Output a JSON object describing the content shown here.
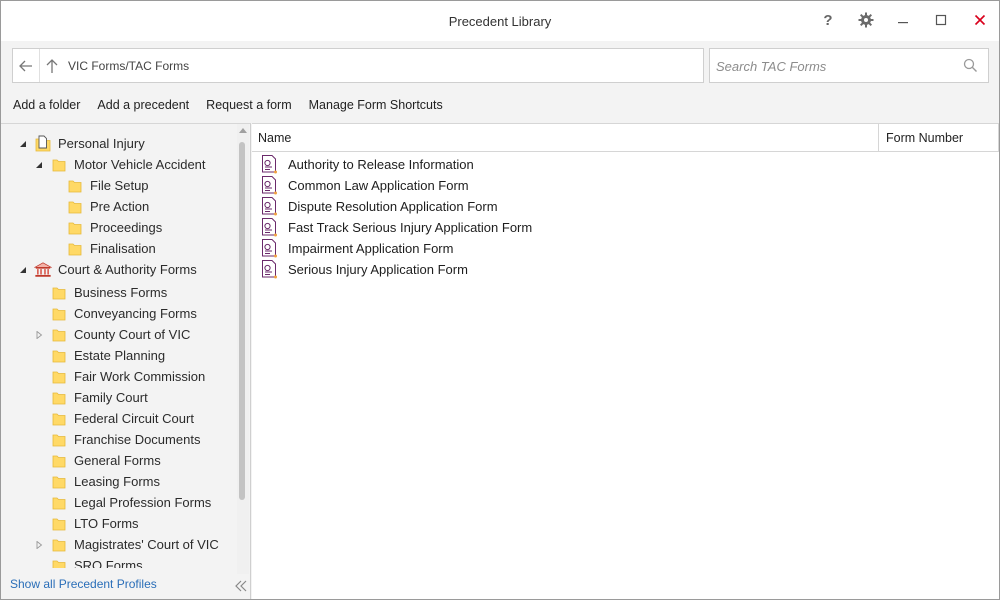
{
  "window": {
    "title": "Precedent Library"
  },
  "titlebar": {
    "help_label": "?"
  },
  "nav": {
    "path": "VIC Forms/TAC Forms"
  },
  "search": {
    "placeholder": "Search TAC Forms"
  },
  "toolbar": {
    "items": [
      "Add a folder",
      "Add a precedent",
      "Request a form",
      "Manage Form Shortcuts"
    ]
  },
  "tree": {
    "nodes": [
      {
        "label": "Personal Injury",
        "level": 0,
        "expander": "expanded",
        "icon": "document-folder-icon"
      },
      {
        "label": "Motor Vehicle Accident",
        "level": 1,
        "expander": "expanded",
        "icon": "folder-icon"
      },
      {
        "label": "File Setup",
        "level": 2,
        "expander": "none",
        "icon": "folder-icon"
      },
      {
        "label": "Pre Action",
        "level": 2,
        "expander": "none",
        "icon": "folder-icon"
      },
      {
        "label": "Proceedings",
        "level": 2,
        "expander": "none",
        "icon": "folder-icon"
      },
      {
        "label": "Finalisation",
        "level": 2,
        "expander": "none",
        "icon": "folder-icon"
      },
      {
        "label": "Court & Authority Forms",
        "level": 0,
        "expander": "expanded",
        "icon": "courthouse-icon"
      },
      {
        "label": "Business Forms",
        "level": 1,
        "expander": "none",
        "icon": "folder-icon"
      },
      {
        "label": "Conveyancing Forms",
        "level": 1,
        "expander": "none",
        "icon": "folder-icon"
      },
      {
        "label": "County Court of VIC",
        "level": 1,
        "expander": "collapsed",
        "icon": "folder-icon"
      },
      {
        "label": "Estate Planning",
        "level": 1,
        "expander": "none",
        "icon": "folder-icon"
      },
      {
        "label": "Fair Work Commission",
        "level": 1,
        "expander": "none",
        "icon": "folder-icon"
      },
      {
        "label": "Family Court",
        "level": 1,
        "expander": "none",
        "icon": "folder-icon"
      },
      {
        "label": "Federal Circuit Court",
        "level": 1,
        "expander": "none",
        "icon": "folder-icon"
      },
      {
        "label": "Franchise Documents",
        "level": 1,
        "expander": "none",
        "icon": "folder-icon"
      },
      {
        "label": "General Forms",
        "level": 1,
        "expander": "none",
        "icon": "folder-icon"
      },
      {
        "label": "Leasing Forms",
        "level": 1,
        "expander": "none",
        "icon": "folder-icon"
      },
      {
        "label": "Legal Profession Forms",
        "level": 1,
        "expander": "none",
        "icon": "folder-icon"
      },
      {
        "label": "LTO Forms",
        "level": 1,
        "expander": "none",
        "icon": "folder-icon"
      },
      {
        "label": "Magistrates' Court of VIC",
        "level": 1,
        "expander": "collapsed",
        "icon": "folder-icon"
      },
      {
        "label": "SRO Forms",
        "level": 1,
        "expander": "none",
        "icon": "folder-icon"
      }
    ],
    "show_all_label": "Show all Precedent Profiles"
  },
  "list": {
    "columns": [
      "Name",
      "Form Number"
    ],
    "rows": [
      {
        "name": "Authority to Release Information",
        "number": ""
      },
      {
        "name": "Common Law Application Form",
        "number": ""
      },
      {
        "name": "Dispute Resolution Application Form",
        "number": ""
      },
      {
        "name": "Fast Track Serious Injury Application Form",
        "number": ""
      },
      {
        "name": "Impairment Application Form",
        "number": ""
      },
      {
        "name": "Serious Injury Application Form",
        "number": ""
      }
    ]
  },
  "colors": {
    "accent_link": "#2a6eb8",
    "close": "#d9001b",
    "folder": "#ffd966",
    "form_icon": "#6b2a6b"
  }
}
